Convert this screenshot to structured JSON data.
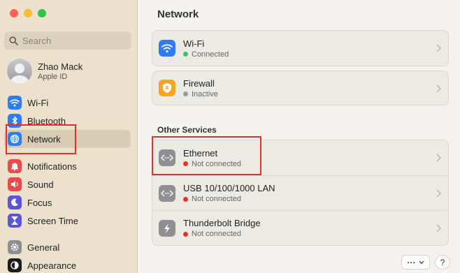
{
  "window": {
    "title": "Network"
  },
  "search": {
    "placeholder": "Search"
  },
  "user": {
    "name": "Zhao Mack",
    "subtitle": "Apple ID"
  },
  "sidebar": {
    "items": [
      {
        "label": "Wi-Fi",
        "icon": "wifi-icon",
        "color": "#2f7cf6"
      },
      {
        "label": "Bluetooth",
        "icon": "bluetooth-icon",
        "color": "#2f7cf6"
      },
      {
        "label": "Network",
        "icon": "globe-icon",
        "color": "#2f7cf6",
        "selected": true
      },
      {
        "label": "Notifications",
        "icon": "bell-icon",
        "color": "#f0484a"
      },
      {
        "label": "Sound",
        "icon": "speaker-icon",
        "color": "#f0484a"
      },
      {
        "label": "Focus",
        "icon": "moon-icon",
        "color": "#5b55d6"
      },
      {
        "label": "Screen Time",
        "icon": "hourglass-icon",
        "color": "#5b55d6"
      },
      {
        "label": "General",
        "icon": "gear-icon",
        "color": "#8e8e93"
      },
      {
        "label": "Appearance",
        "icon": "appearance-icon",
        "color": "#1c1c1e"
      }
    ]
  },
  "services": [
    {
      "title": "Wi-Fi",
      "status": "Connected",
      "status_color": "#34c759",
      "icon": "wifi-icon",
      "color": "#2f7cf6"
    },
    {
      "title": "Firewall",
      "status": "Inactive",
      "status_color": "#9a9a9a",
      "icon": "shield-icon",
      "color": "#f5a524"
    }
  ],
  "other_services": {
    "title": "Other Services",
    "items": [
      {
        "title": "Ethernet",
        "status": "Not connected",
        "status_color": "#e5352b",
        "icon": "ethernet-icon"
      },
      {
        "title": "USB 10/100/1000 LAN",
        "status": "Not connected",
        "status_color": "#e5352b",
        "icon": "ethernet-icon"
      },
      {
        "title": "Thunderbolt Bridge",
        "status": "Not connected",
        "status_color": "#e5352b",
        "icon": "thunderbolt-icon"
      }
    ]
  },
  "buttons": {
    "more_label": "···",
    "help_label": "?"
  },
  "colors": {
    "highlight_box": "#e0322d",
    "sidebar_bg": "#ebe1cd"
  }
}
